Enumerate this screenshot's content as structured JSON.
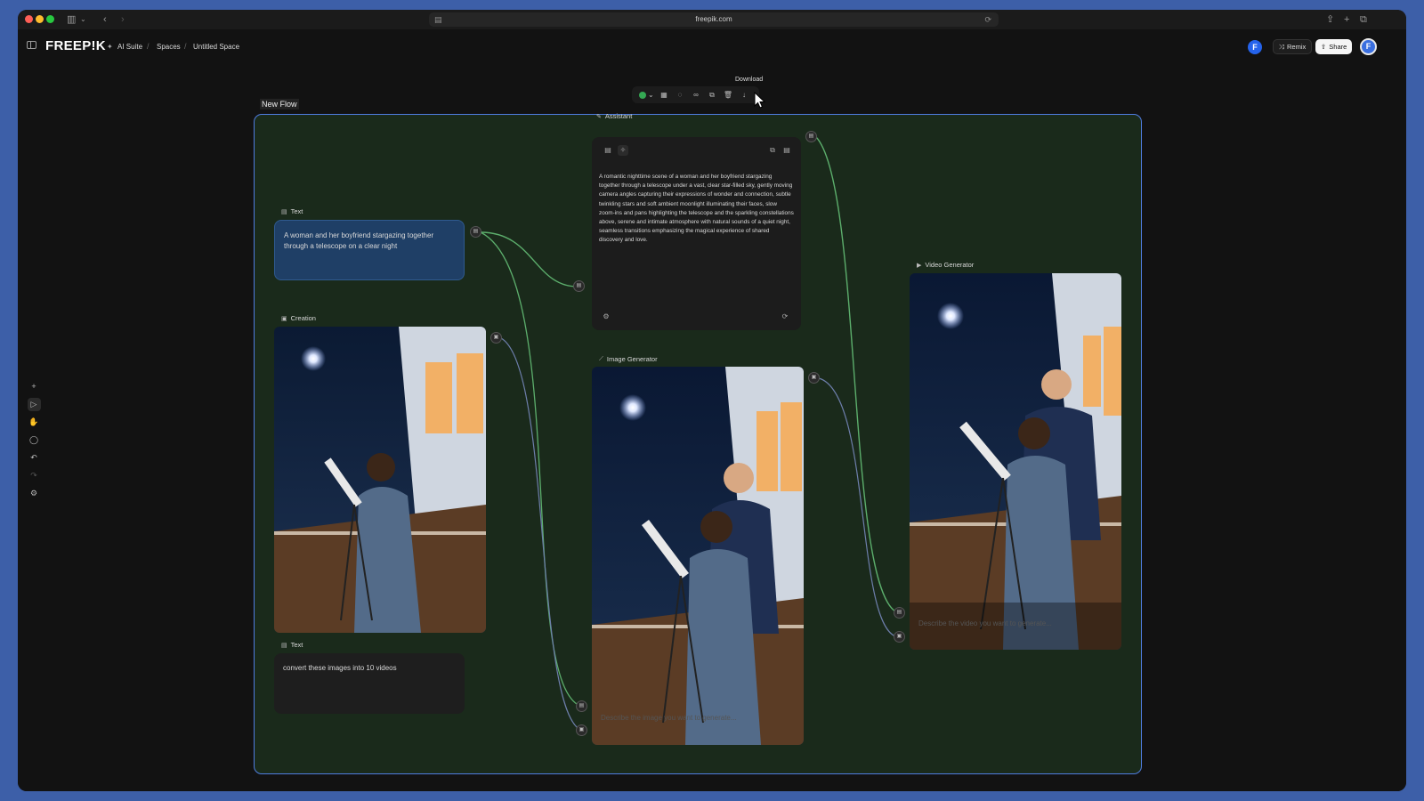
{
  "browser": {
    "url": "freepik.com"
  },
  "header": {
    "logo": "FREEP!K",
    "breadcrumbs": [
      "AI Suite",
      "Spaces",
      "Untitled Space"
    ],
    "remix_label": "Remix",
    "share_label": "Share",
    "avatar_initial": "F"
  },
  "toolbar": {
    "tooltip": "Download"
  },
  "flow": {
    "group_title": "New Flow",
    "text_node_1": {
      "label": "Text",
      "content": "A woman and her boyfriend stargazing together through a telescope on a clear night"
    },
    "creation_node": {
      "label": "Creation"
    },
    "text_node_2": {
      "label": "Text",
      "content": "convert these images into 10 videos"
    },
    "assistant": {
      "label": "Assistant",
      "content": "A romantic nighttime scene of a woman and her boyfriend stargazing together through a telescope under a vast, clear star-filled sky, gently moving camera angles capturing their expressions of wonder and connection, subtle twinkling stars and soft ambient moonlight illuminating their faces, slow zoom-ins and pans highlighting the telescope and the sparkling constellations above, serene and intimate atmosphere with natural sounds of a quiet night, seamless transitions emphasizing the magical experience of shared discovery and love."
    },
    "image_generator": {
      "label": "Image Generator",
      "placeholder": "Describe the image you want to generate..."
    },
    "video_generator": {
      "label": "Video Generator",
      "placeholder": "Describe the video you want to generate..."
    }
  },
  "colors": {
    "group_border": "#4f7de0",
    "group_bg": "#1a2a1b",
    "edge_green": "#5cae6c",
    "text_node_bg": "#1f3f66"
  }
}
